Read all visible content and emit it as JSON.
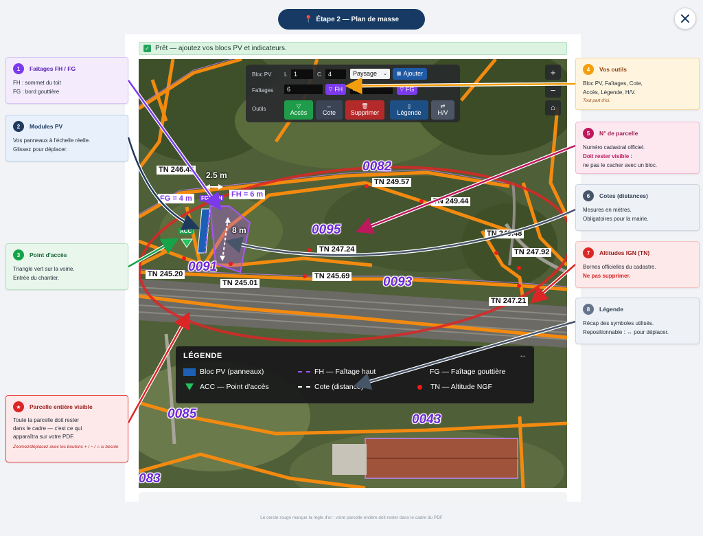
{
  "header": {
    "title": "Étape 2 — Plan de masse",
    "pin_icon": "map-pin-icon",
    "close_icon": "close-icon"
  },
  "banner": {
    "text": "Prêt — ajoutez vos blocs PV et indicateurs."
  },
  "toolbar": {
    "row1_label": "Bloc PV",
    "l_label": "L",
    "l_value": "1",
    "c_label": "C",
    "c_value": "4",
    "orientation": "Paysage",
    "add_label": "Ajouter",
    "row2_label": "Faîtages",
    "fh_value": "6",
    "fh_label": "FH",
    "fg_value": "4",
    "fg_label": "FG",
    "row3_label": "Outils",
    "tools": [
      {
        "glyph": "▽",
        "label": "Accès",
        "color": "#1f9c4a"
      },
      {
        "glyph": "↔",
        "label": "Cote",
        "color": "#3a4455"
      },
      {
        "glyph": "🗑",
        "label": "Supprimer",
        "color": "#b42a2a"
      },
      {
        "glyph": "▯",
        "label": "Légende",
        "color": "#1d4f85"
      },
      {
        "glyph": "⇄",
        "label": "H/V",
        "color": "#4b5563"
      }
    ]
  },
  "zoom": {
    "in": "+",
    "out": "−",
    "home": "⌂"
  },
  "map": {
    "parcels": [
      "0082",
      "0095",
      "0091",
      "0093",
      "0085",
      "0043",
      "083"
    ],
    "tn_labels": [
      "TN 246.46",
      "TN 249.57",
      "TN 249.44",
      "TN 247.24",
      "TN 249.48",
      "TN 247.92",
      "TN 245.20",
      "TN 245.01",
      "TN 245.69",
      "TN 247.21"
    ],
    "dims": {
      "width": "2.5 m",
      "height": "8 m",
      "fg": "FG = 4 m",
      "fh": "FH = 6 m",
      "acc": "ACC",
      "tag_fg": "FG",
      "tag_fh": "H"
    }
  },
  "legend": {
    "title": "LÉGENDE",
    "move_icon": "↔",
    "items": [
      "Bloc PV (panneaux)",
      "FH — Faîtage haut",
      "FG — Faîtage gouttière",
      "ACC — Point d'accès",
      "Cote (distance)",
      "TN — Altitude NGF"
    ]
  },
  "callouts": [
    {
      "num": "1",
      "title": "Faîtages FH / FG",
      "lines": [
        "FH : sommet du toit",
        "FG : bord gouttière"
      ],
      "color": "#7c3aed"
    },
    {
      "num": "2",
      "title": "Modules PV",
      "lines": [
        "Vos panneaux à l'échelle réelle.",
        "Glissez pour déplacer."
      ],
      "color": "#1f3a5f"
    },
    {
      "num": "3",
      "title": "Point d'accès",
      "lines": [
        "Triangle vert sur la voirie.",
        "Entrée du chantier."
      ],
      "color": "#16a34a"
    },
    {
      "num": "★",
      "title": "Parcelle entière visible",
      "lines": [
        "Toute la parcelle doit rester",
        "dans le cadre — c'est ce qui",
        "apparaîtra sur votre PDF."
      ],
      "note": "Zoomez/déplacez avec les boutons + / − / ⌂ si besoin",
      "color": "#dc2626"
    },
    {
      "num": "4",
      "title": "Vos outils",
      "lines": [
        "Bloc PV, Faîtages, Cote,",
        "Accès, Légende, H/V."
      ],
      "note": "Tout part d'ici.",
      "color": "#f59e0b"
    },
    {
      "num": "5",
      "title": "N° de parcelle",
      "lines": [
        "Numéro cadastral officiel."
      ],
      "em": "Doit rester visible :",
      "after": "ne pas le cacher avec un bloc.",
      "color": "#be185d"
    },
    {
      "num": "6",
      "title": "Cotes (distances)",
      "lines": [
        "Mesures en mètres.",
        "Obligatoires pour la mairie."
      ],
      "color": "#475569"
    },
    {
      "num": "7",
      "title": "Altitudes IGN (TN)",
      "lines": [
        "Bornes officielles du cadastre."
      ],
      "em": "Ne pas supprimer.",
      "color": "#dc2626"
    },
    {
      "num": "8",
      "title": "Légende",
      "lines": [
        "Récap des symboles utilisés.",
        "Repositionnable : ↔ pour déplacer."
      ],
      "color": "#64748b"
    }
  ],
  "footer": "Le cercle rouge marque la règle d'or : votre parcelle entière doit rester dans le cadre du PDF"
}
